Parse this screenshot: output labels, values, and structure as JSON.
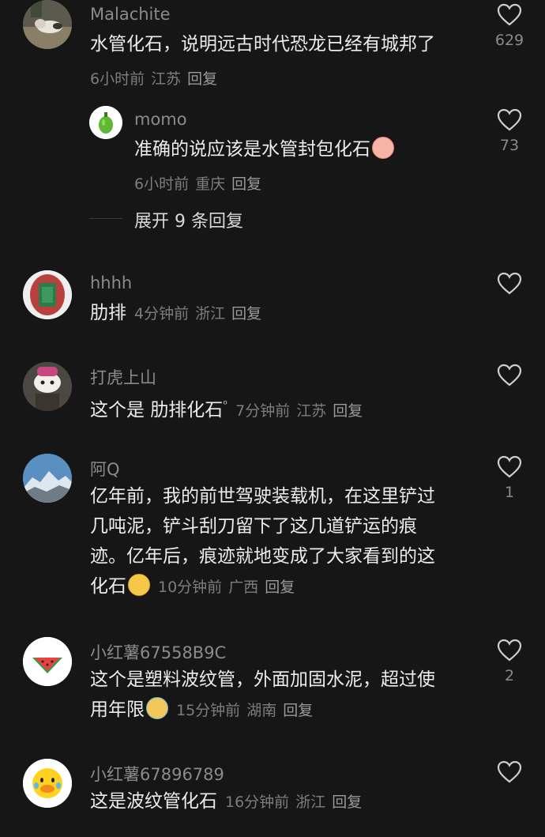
{
  "comments": [
    {
      "username": "Malachite",
      "lines": [
        "水管化石，说明远古时代恐龙已经有城邦了"
      ],
      "time": "6小时前",
      "location": "江苏",
      "reply": "回复",
      "likes": "629",
      "avatar_icon": "cat-photo-avatar"
    },
    {
      "username": "momo",
      "lines": [
        "准确的说应该是水管封包化石"
      ],
      "time": "6小时前",
      "location": "重庆",
      "reply": "回复",
      "likes": "73",
      "avatar_icon": "green-pepper-avatar",
      "emoji": "pig-blush-emoji"
    },
    {
      "username": "hhhh",
      "lines": [
        "肋排"
      ],
      "time": "4分钟前",
      "location": "浙江",
      "reply": "回复",
      "likes": "",
      "avatar_icon": "stadium-avatar"
    },
    {
      "username": "打虎上山",
      "lines": [
        "这个是 肋排化石"
      ],
      "time": "7分钟前",
      "location": "江苏",
      "reply": "回复",
      "likes": "",
      "avatar_icon": "alpaca-plush-avatar",
      "search_mark": "ᵒ"
    },
    {
      "username": "阿Q",
      "lines": [
        "亿年前，我的前世驾驶装载机，在这里铲过",
        "几吨泥，铲斗刮刀留下了这几道铲运的痕",
        "迹。亿年后，痕迹就地变成了大家看到的这",
        "化石"
      ],
      "time": "10分钟前",
      "location": "广西",
      "reply": "回复",
      "likes": "1",
      "avatar_icon": "mountain-avatar",
      "emoji": "sunglasses-emoji"
    },
    {
      "username": "小红薯67558B9C",
      "lines": [
        "这个是塑料波纹管，外面加固水泥，超过使",
        "用年限"
      ],
      "time": "15分钟前",
      "location": "湖南",
      "reply": "回复",
      "likes": "2",
      "avatar_icon": "watermelon-avatar",
      "emoji": "crying-emoji"
    },
    {
      "username": "小红薯67896789",
      "lines": [
        "这是波纹管化石"
      ],
      "time": "16分钟前",
      "location": "浙江",
      "reply": "回复",
      "likes": "",
      "avatar_icon": "duck-emoji-avatar"
    }
  ],
  "expand_replies": "展开 9 条回复",
  "colors": {
    "background": "#161616",
    "username": "#8b8b8b",
    "text": "#ececec",
    "meta": "#7d7d7d"
  }
}
